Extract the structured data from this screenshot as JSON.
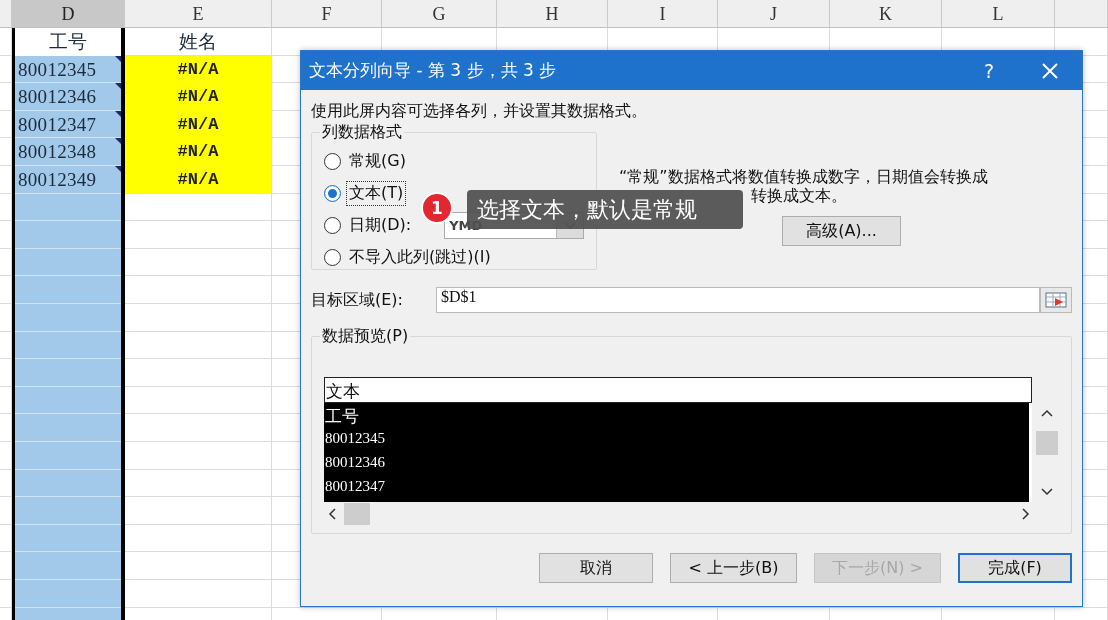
{
  "sheet": {
    "columns": [
      {
        "label": "D",
        "selected": true
      },
      {
        "label": "E",
        "selected": false
      },
      {
        "label": "F",
        "selected": false
      },
      {
        "label": "G",
        "selected": false
      },
      {
        "label": "H",
        "selected": false
      },
      {
        "label": "I",
        "selected": false
      },
      {
        "label": "J",
        "selected": false
      },
      {
        "label": "K",
        "selected": false
      },
      {
        "label": "L",
        "selected": false
      }
    ],
    "rows": [
      {
        "cells": [
          "工号",
          "姓名"
        ],
        "active": true,
        "flagged": false,
        "highlighted": false
      },
      {
        "cells": [
          "80012345",
          "#N/A"
        ],
        "active": false,
        "flagged": true,
        "highlighted": true
      },
      {
        "cells": [
          "80012346",
          "#N/A"
        ],
        "active": false,
        "flagged": true,
        "highlighted": true
      },
      {
        "cells": [
          "80012347",
          "#N/A"
        ],
        "active": false,
        "flagged": true,
        "highlighted": true
      },
      {
        "cells": [
          "80012348",
          "#N/A"
        ],
        "active": false,
        "flagged": true,
        "highlighted": true
      },
      {
        "cells": [
          "80012349",
          "#N/A"
        ],
        "active": false,
        "flagged": true,
        "highlighted": true
      }
    ]
  },
  "dialog": {
    "title": "文本分列向导 - 第 3 步，共 3 步",
    "help": "?",
    "instruction": "使用此屏内容可选择各列，并设置其数据格式。",
    "format_group": {
      "legend": "列数据格式",
      "options": [
        {
          "label": "常规(G)",
          "selected": false
        },
        {
          "label": "文本(T)",
          "selected": true
        },
        {
          "label": "日期(D):",
          "selected": false
        },
        {
          "label": "不导入此列(跳过)(I)",
          "selected": false
        }
      ]
    },
    "date_select": {
      "value": "YMD",
      "disabled": true
    },
    "description": [
      "“常规”数据格式将数值转换成数字，日期值会转换成",
      "转换成文本。"
    ],
    "advanced_button": "高级(A)...",
    "target": {
      "label": "目标区域(E):",
      "value": "$D$1"
    },
    "preview": {
      "legend": "数据预览(P)",
      "header": "文本",
      "rows": [
        "工号",
        "80012345",
        "80012346",
        "80012347"
      ]
    },
    "buttons": [
      {
        "label": "取消",
        "disabled": false,
        "default": false
      },
      {
        "label": "< 上一步(B)",
        "disabled": false,
        "default": false
      },
      {
        "label": "下一步(N) >",
        "disabled": true,
        "default": false
      },
      {
        "label": "完成(F)",
        "disabled": false,
        "default": true
      }
    ]
  },
  "callout": {
    "badge": "1",
    "text": "选择文本，默认是常规"
  }
}
